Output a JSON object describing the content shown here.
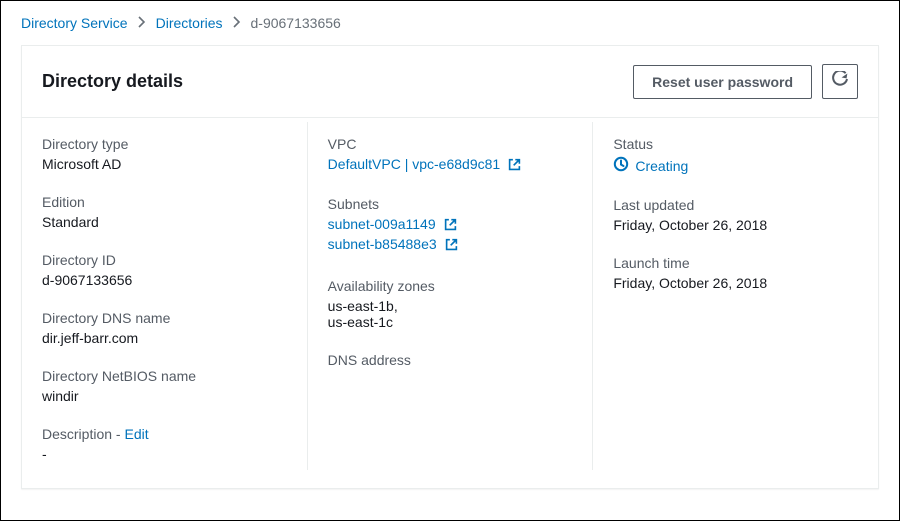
{
  "breadcrumb": {
    "service": "Directory Service",
    "directories": "Directories",
    "current": "d-9067133656"
  },
  "header": {
    "title": "Directory details",
    "reset_label": "Reset user password"
  },
  "col1": {
    "directory_type_label": "Directory type",
    "directory_type_value": "Microsoft AD",
    "edition_label": "Edition",
    "edition_value": "Standard",
    "directory_id_label": "Directory ID",
    "directory_id_value": "d-9067133656",
    "dns_name_label": "Directory DNS name",
    "dns_name_value": "dir.jeff-barr.com",
    "netbios_label": "Directory NetBIOS name",
    "netbios_value": "windir",
    "description_label": "Description",
    "description_separator": " - ",
    "edit_label": "Edit",
    "description_value": "-"
  },
  "col2": {
    "vpc_label": "VPC",
    "vpc_value": "DefaultVPC | vpc-e68d9c81",
    "subnets_label": "Subnets",
    "subnet1": "subnet-009a1149",
    "subnet2": "subnet-b85488e3",
    "az_label": "Availability zones",
    "az_value": "us-east-1b,\nus-east-1c",
    "dns_addr_label": "DNS address"
  },
  "col3": {
    "status_label": "Status",
    "status_value": "Creating",
    "last_updated_label": "Last updated",
    "last_updated_value": "Friday, October 26, 2018",
    "launch_time_label": "Launch time",
    "launch_time_value": "Friday, October 26, 2018"
  }
}
